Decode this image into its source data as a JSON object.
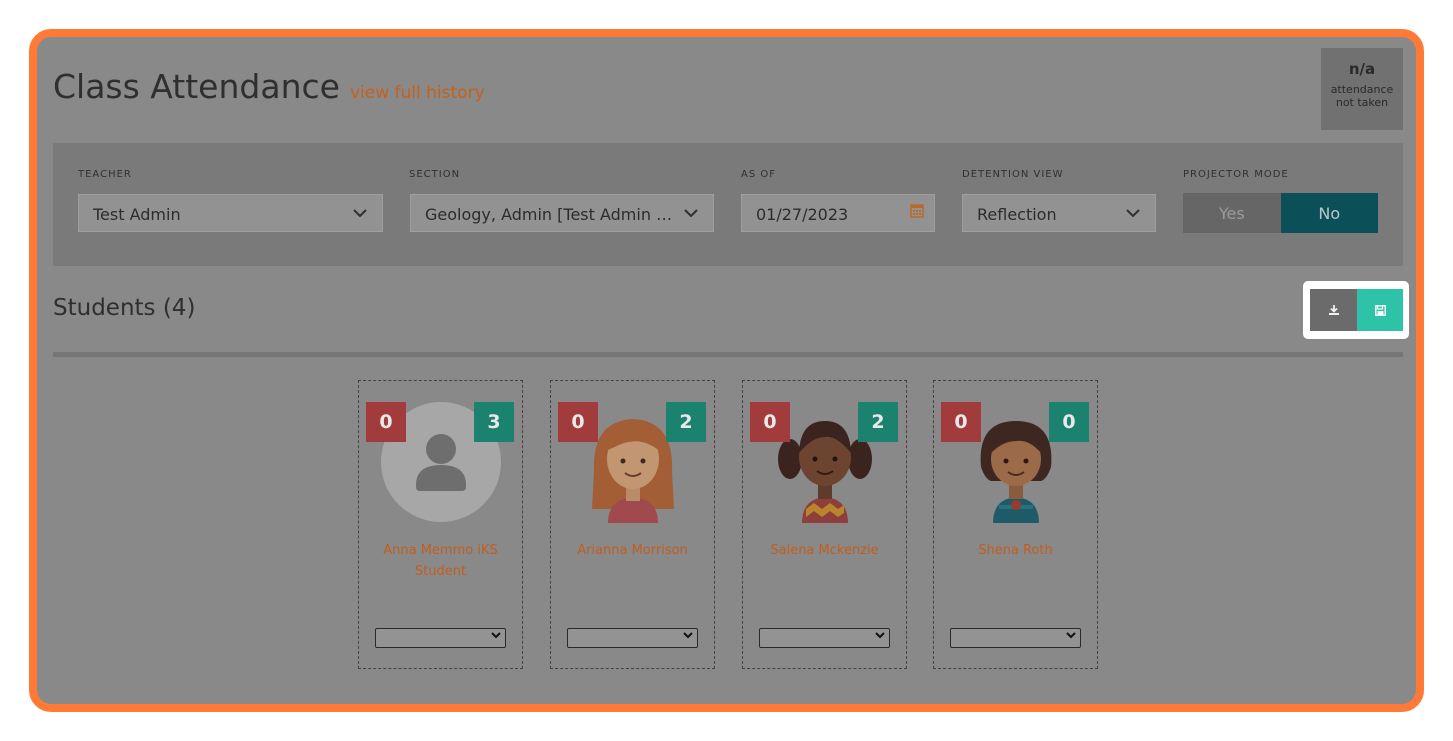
{
  "header": {
    "title": "Class Attendance",
    "history_link": "view full history"
  },
  "attendance": {
    "value": "n/a",
    "label_line1": "attendance",
    "label_line2": "not taken"
  },
  "filters": {
    "teacher": {
      "label": "TEACHER",
      "value": "Test Admin"
    },
    "section": {
      "label": "SECTION",
      "value": "Geology, Admin [Test Admin Section]"
    },
    "as_of": {
      "label": "AS OF",
      "value": "01/27/2023"
    },
    "detention_view": {
      "label": "DETENTION VIEW",
      "value": "Reflection"
    },
    "projector_mode": {
      "label": "PROJECTOR MODE",
      "yes": "Yes",
      "no": "No",
      "selected": "No"
    }
  },
  "students_title": "Students (4)",
  "students": [
    {
      "name": "Anna Memmo iKS Student",
      "red": "0",
      "green": "3",
      "avatar": "default-user-avatar",
      "select_value": ""
    },
    {
      "name": "Arianna Morrison",
      "red": "0",
      "green": "2",
      "avatar": "girl-long-hair-avatar",
      "select_value": ""
    },
    {
      "name": "Salena Mckenzie",
      "red": "0",
      "green": "2",
      "avatar": "girl-pigtails-avatar",
      "select_value": ""
    },
    {
      "name": "Shena Roth",
      "red": "0",
      "green": "0",
      "avatar": "girl-short-hair-avatar",
      "select_value": ""
    }
  ],
  "colors": {
    "accent_orange": "#ff7a36",
    "link_orange": "#c7601a",
    "badge_red": "#a23c3c",
    "badge_green": "#1c8270",
    "save_teal": "#2ec3a8",
    "projector_no": "#0b4f58"
  },
  "icons": {
    "calendar": "calendar-icon",
    "download": "download-icon",
    "save": "save-icon"
  }
}
